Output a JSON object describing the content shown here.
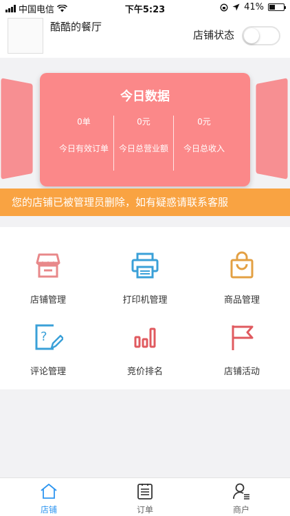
{
  "status_bar": {
    "carrier": "中国电信",
    "time": "下午5:23",
    "battery": "41%",
    "battery_level": 0.41
  },
  "header": {
    "shop_name": "酷酷的餐厅",
    "store_status_label": "店铺状态",
    "store_status_on": false
  },
  "today_card": {
    "title": "今日数据",
    "stats": [
      {
        "value": "0单",
        "label": "今日有效订单"
      },
      {
        "value": "0元",
        "label": "今日总营业额"
      },
      {
        "value": "0元",
        "label": "今日总收入"
      }
    ]
  },
  "notice": "您的店铺已被管理员删除，如有疑惑请联系客服",
  "menu": [
    {
      "label": "店铺管理",
      "icon": "store-icon",
      "color": "#e8888a"
    },
    {
      "label": "打印机管理",
      "icon": "printer-icon",
      "color": "#3aa0d8"
    },
    {
      "label": "商品管理",
      "icon": "shopping-bag-icon",
      "color": "#e3a043"
    },
    {
      "label": "评论管理",
      "icon": "comment-edit-icon",
      "color": "#3aa0d8"
    },
    {
      "label": "竞价排名",
      "icon": "bar-chart-icon",
      "color": "#e05a5f"
    },
    {
      "label": "店铺活动",
      "icon": "flag-icon",
      "color": "#e05a5f"
    }
  ],
  "tabs": [
    {
      "label": "店铺",
      "icon": "home-icon",
      "active": true
    },
    {
      "label": "订单",
      "icon": "order-list-icon",
      "active": false
    },
    {
      "label": "商户",
      "icon": "merchant-icon",
      "active": false
    }
  ],
  "colors": {
    "card": "#fb8889",
    "notice": "#f9a342",
    "tab_active": "#2d95f0"
  }
}
